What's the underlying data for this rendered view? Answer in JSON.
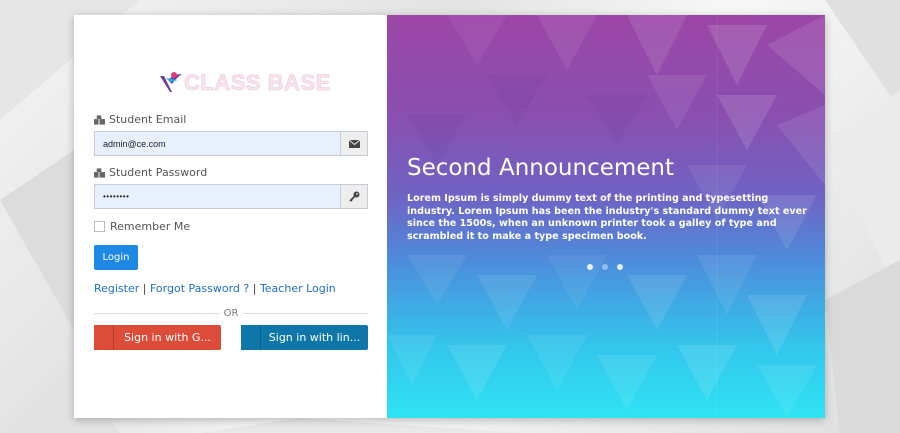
{
  "brand": {
    "logo_text": "CLASS BASE"
  },
  "login_form": {
    "email_label": "Student Email",
    "email_value": "admin@ce.com",
    "password_label": "Student Password",
    "password_value": "••••••••",
    "remember_label": "Remember Me",
    "login_button": "Login",
    "links": {
      "register": "Register",
      "separator": " | ",
      "forgot_password": "Forgot Password ?",
      "teacher_login": "Teacher Login"
    },
    "or_text": "OR",
    "google_button": "Sign in with G...",
    "linkedin_button": "Sign in with lin..."
  },
  "carousel": {
    "title": "Second Announcement",
    "text": "Lorem Ipsum is simply dummy text of the printing and typesetting industry. Lorem Ipsum has been the industry's standard dummy text ever since the 1500s, when an unknown printer took a galley of type and scrambled it to make a type specimen book.",
    "slide_count": 3,
    "active_slide": 2
  },
  "colors": {
    "login_button": "#1e88e5",
    "google": "#dd4b39",
    "linkedin": "#0e76a8",
    "gradient_top": "#9c46a6",
    "gradient_bottom": "#2fe3f4"
  },
  "icons": {
    "email_addon": "envelope-icon",
    "password_addon": "key-icon",
    "label_icon": "user-group-icon"
  }
}
